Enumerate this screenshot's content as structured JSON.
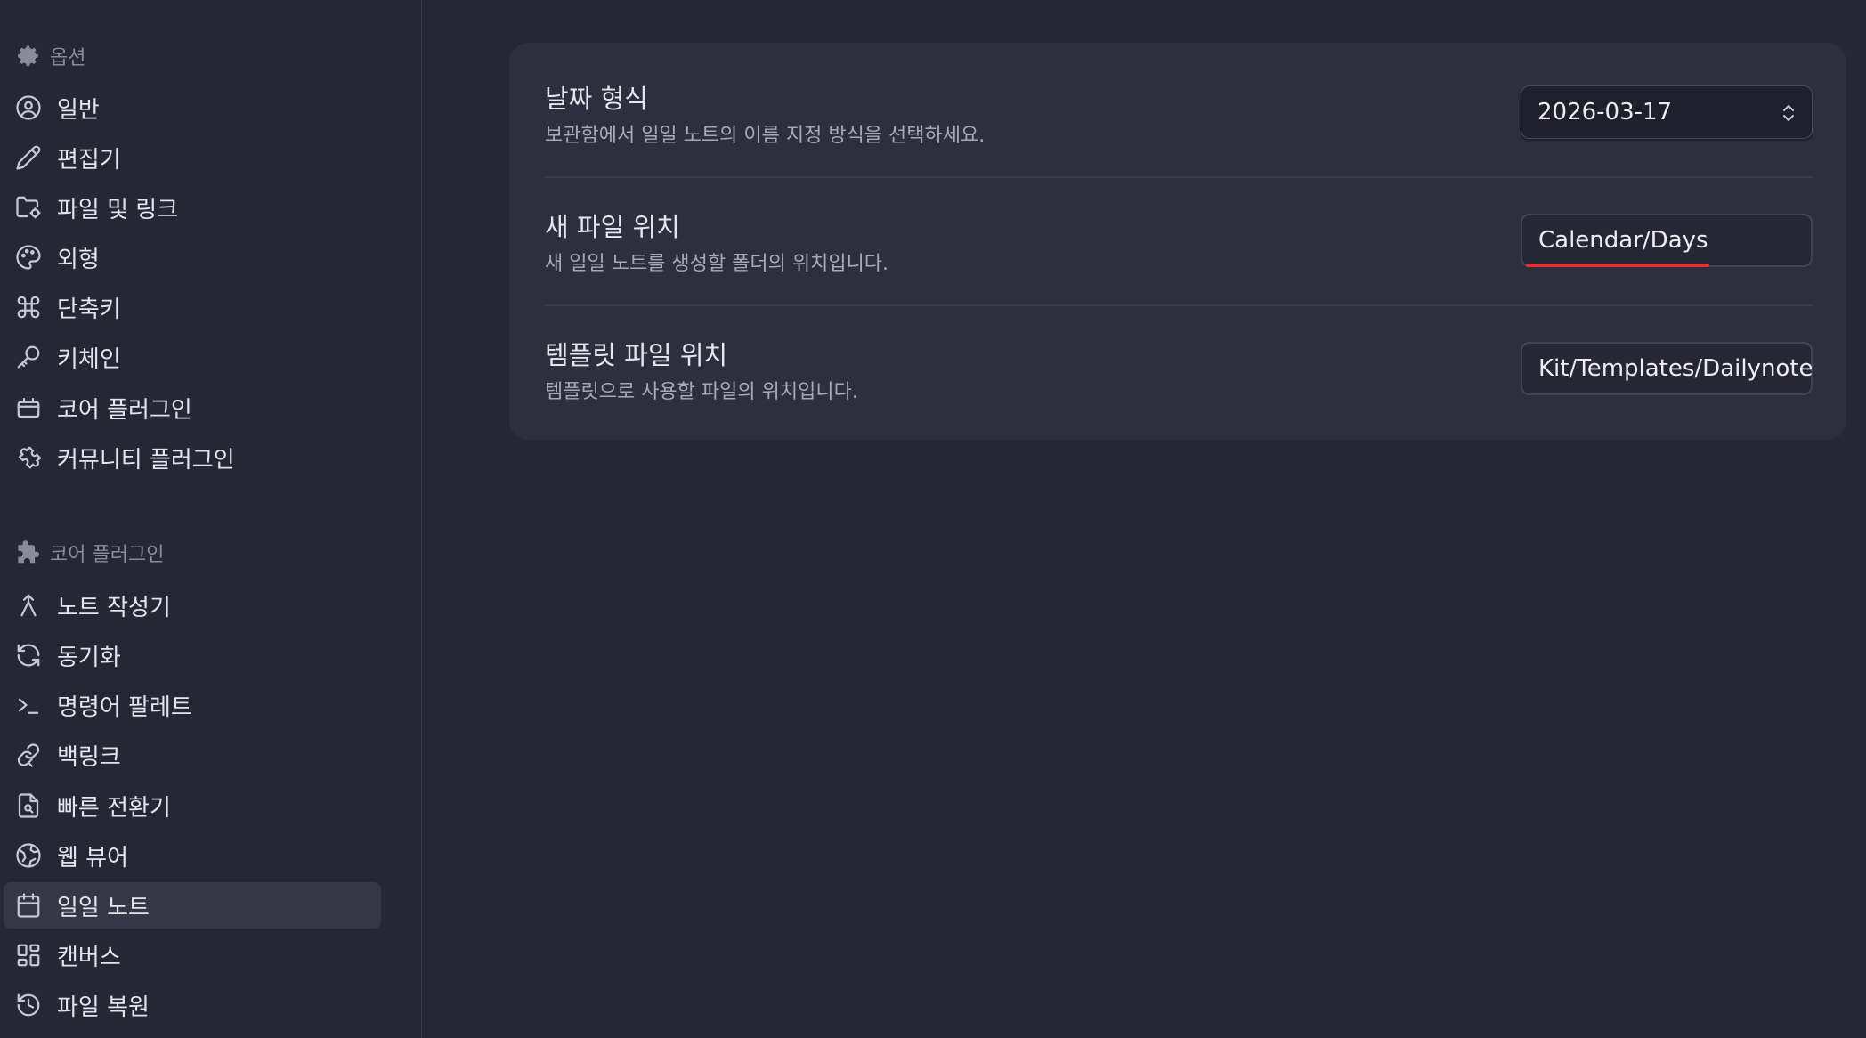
{
  "sidebar": {
    "options_header": "옵션",
    "options_items": [
      {
        "label": "일반",
        "icon": "user-circle-icon"
      },
      {
        "label": "편집기",
        "icon": "pencil-icon"
      },
      {
        "label": "파일 및 링크",
        "icon": "folder-cog-icon"
      },
      {
        "label": "외형",
        "icon": "palette-icon"
      },
      {
        "label": "단축키",
        "icon": "command-icon"
      },
      {
        "label": "키체인",
        "icon": "key-icon"
      },
      {
        "label": "코어 플러그인",
        "icon": "briefcase-icon"
      },
      {
        "label": "커뮤니티 플러그인",
        "icon": "puzzle-icon"
      }
    ],
    "core_header": "코어 플러그인",
    "core_items": [
      {
        "label": "노트 작성기",
        "icon": "merge-icon"
      },
      {
        "label": "동기화",
        "icon": "refresh-icon"
      },
      {
        "label": "명령어 팔레트",
        "icon": "terminal-icon"
      },
      {
        "label": "백링크",
        "icon": "backlink-icon"
      },
      {
        "label": "빠른 전환기",
        "icon": "file-search-icon"
      },
      {
        "label": "웹 뷰어",
        "icon": "globe-icon"
      },
      {
        "label": "일일 노트",
        "icon": "calendar-icon",
        "active": true
      },
      {
        "label": "캔버스",
        "icon": "grid-icon"
      },
      {
        "label": "파일 복원",
        "icon": "history-icon"
      }
    ]
  },
  "settings": [
    {
      "name": "날짜 형식",
      "desc": "보관함에서 일일 노트의 이름 지정 방식을 선택하세요.",
      "value": "2026-03-17",
      "control": "select"
    },
    {
      "name": "새 파일 위치",
      "desc": "새 일일 노트를 생성할 폴더의 위치입니다.",
      "value": "Calendar/Days",
      "control": "text"
    },
    {
      "name": "템플릿 파일 위치",
      "desc": "템플릿으로 사용할 파일의 위치입니다.",
      "value": "Kit/Templates/Dailynote",
      "control": "text"
    }
  ],
  "colors": {
    "background": "#262635",
    "panel": "#2e2e3e",
    "active_item": "#363646",
    "spellcheck_underline": "#e2312e"
  }
}
